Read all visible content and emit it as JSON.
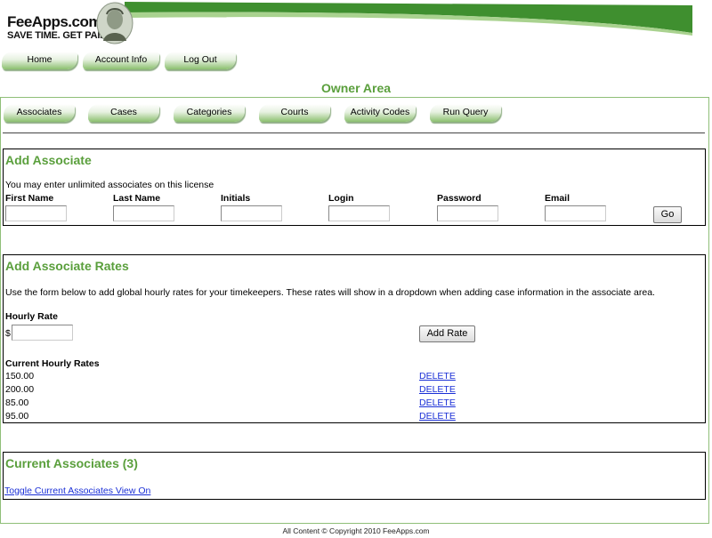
{
  "brand": {
    "name": "FeeApps.com",
    "tagline": "SAVE TIME. GET PAID.",
    "accent": "#5a9f3c"
  },
  "topnav": [
    "Home",
    "Account Info",
    "Log Out"
  ],
  "page_title": "Owner Area",
  "subnav": [
    "Associates",
    "Cases",
    "Categories",
    "Courts",
    "Activity Codes",
    "Run Query"
  ],
  "add_associate": {
    "title": "Add Associate",
    "note": "You may enter unlimited associates on this license",
    "fields": [
      "First Name",
      "Last Name",
      "Initials",
      "Login",
      "Password",
      "Email"
    ],
    "go_label": "Go"
  },
  "rates": {
    "title": "Add Associate Rates",
    "description": "Use the form below to add global hourly rates for your timekeepers. These rates will show in a dropdown when adding case information in the associate area.",
    "hourly_rate_label": "Hourly Rate",
    "currency": "$",
    "add_label": "Add Rate",
    "current_label": "Current Hourly Rates",
    "list": [
      {
        "value": "150.00",
        "action": "DELETE"
      },
      {
        "value": "200.00",
        "action": "DELETE"
      },
      {
        "value": "85.00",
        "action": "DELETE"
      },
      {
        "value": "95.00",
        "action": "DELETE"
      }
    ]
  },
  "current": {
    "title": "Current Associates (3)",
    "toggle": "Toggle Current Associates View On"
  },
  "footer": "All Content © Copyright 2010 FeeApps.com"
}
